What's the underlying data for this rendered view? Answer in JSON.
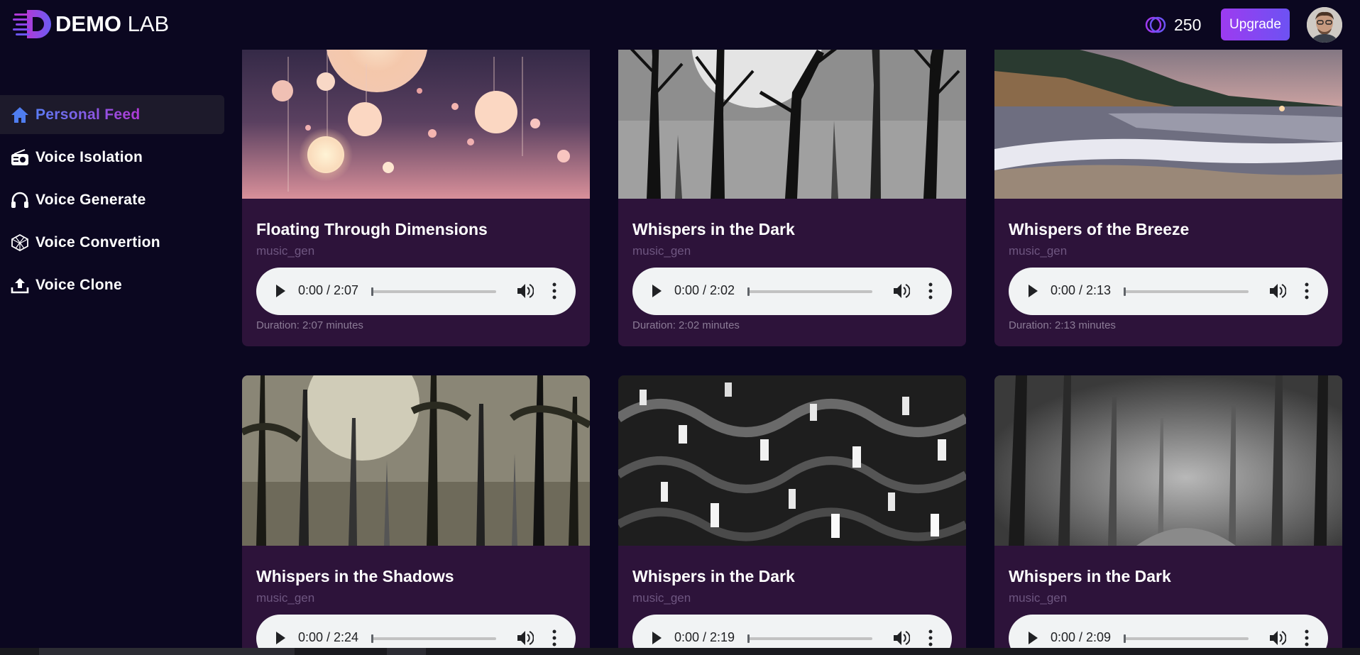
{
  "app": {
    "logo_bold": "DEMO",
    "logo_thin": "LAB",
    "credits": "250",
    "upgrade_label": "Upgrade",
    "accent_gradient": [
      "#9d3bf0",
      "#6d52f3"
    ]
  },
  "sidebar": {
    "items": [
      {
        "label": "Personal Feed",
        "icon": "home-icon",
        "active": true
      },
      {
        "label": "Voice Isolation",
        "icon": "radio-icon",
        "active": false
      },
      {
        "label": "Voice Generate",
        "icon": "headphones-icon",
        "active": false
      },
      {
        "label": "Voice Convertion",
        "icon": "cube-icon",
        "active": false
      },
      {
        "label": "Voice Clone",
        "icon": "upload-icon",
        "active": false
      }
    ]
  },
  "feed": {
    "cards": [
      {
        "title": "Floating Through Dimensions",
        "tag": "music_gen",
        "time": "0:00 / 2:07",
        "duration": "Duration: 2:07 minutes"
      },
      {
        "title": "Whispers in the Dark",
        "tag": "music_gen",
        "time": "0:00 / 2:02",
        "duration": "Duration: 2:02 minutes"
      },
      {
        "title": "Whispers of the Breeze",
        "tag": "music_gen",
        "time": "0:00 / 2:13",
        "duration": "Duration: 2:13 minutes"
      },
      {
        "title": "Whispers in the Shadows",
        "tag": "music_gen",
        "time": "0:00 / 2:24",
        "duration": ""
      },
      {
        "title": "Whispers in the Dark",
        "tag": "music_gen",
        "time": "0:00 / 2:19",
        "duration": ""
      },
      {
        "title": "Whispers in the Dark",
        "tag": "music_gen",
        "time": "0:00 / 2:09",
        "duration": ""
      }
    ]
  }
}
